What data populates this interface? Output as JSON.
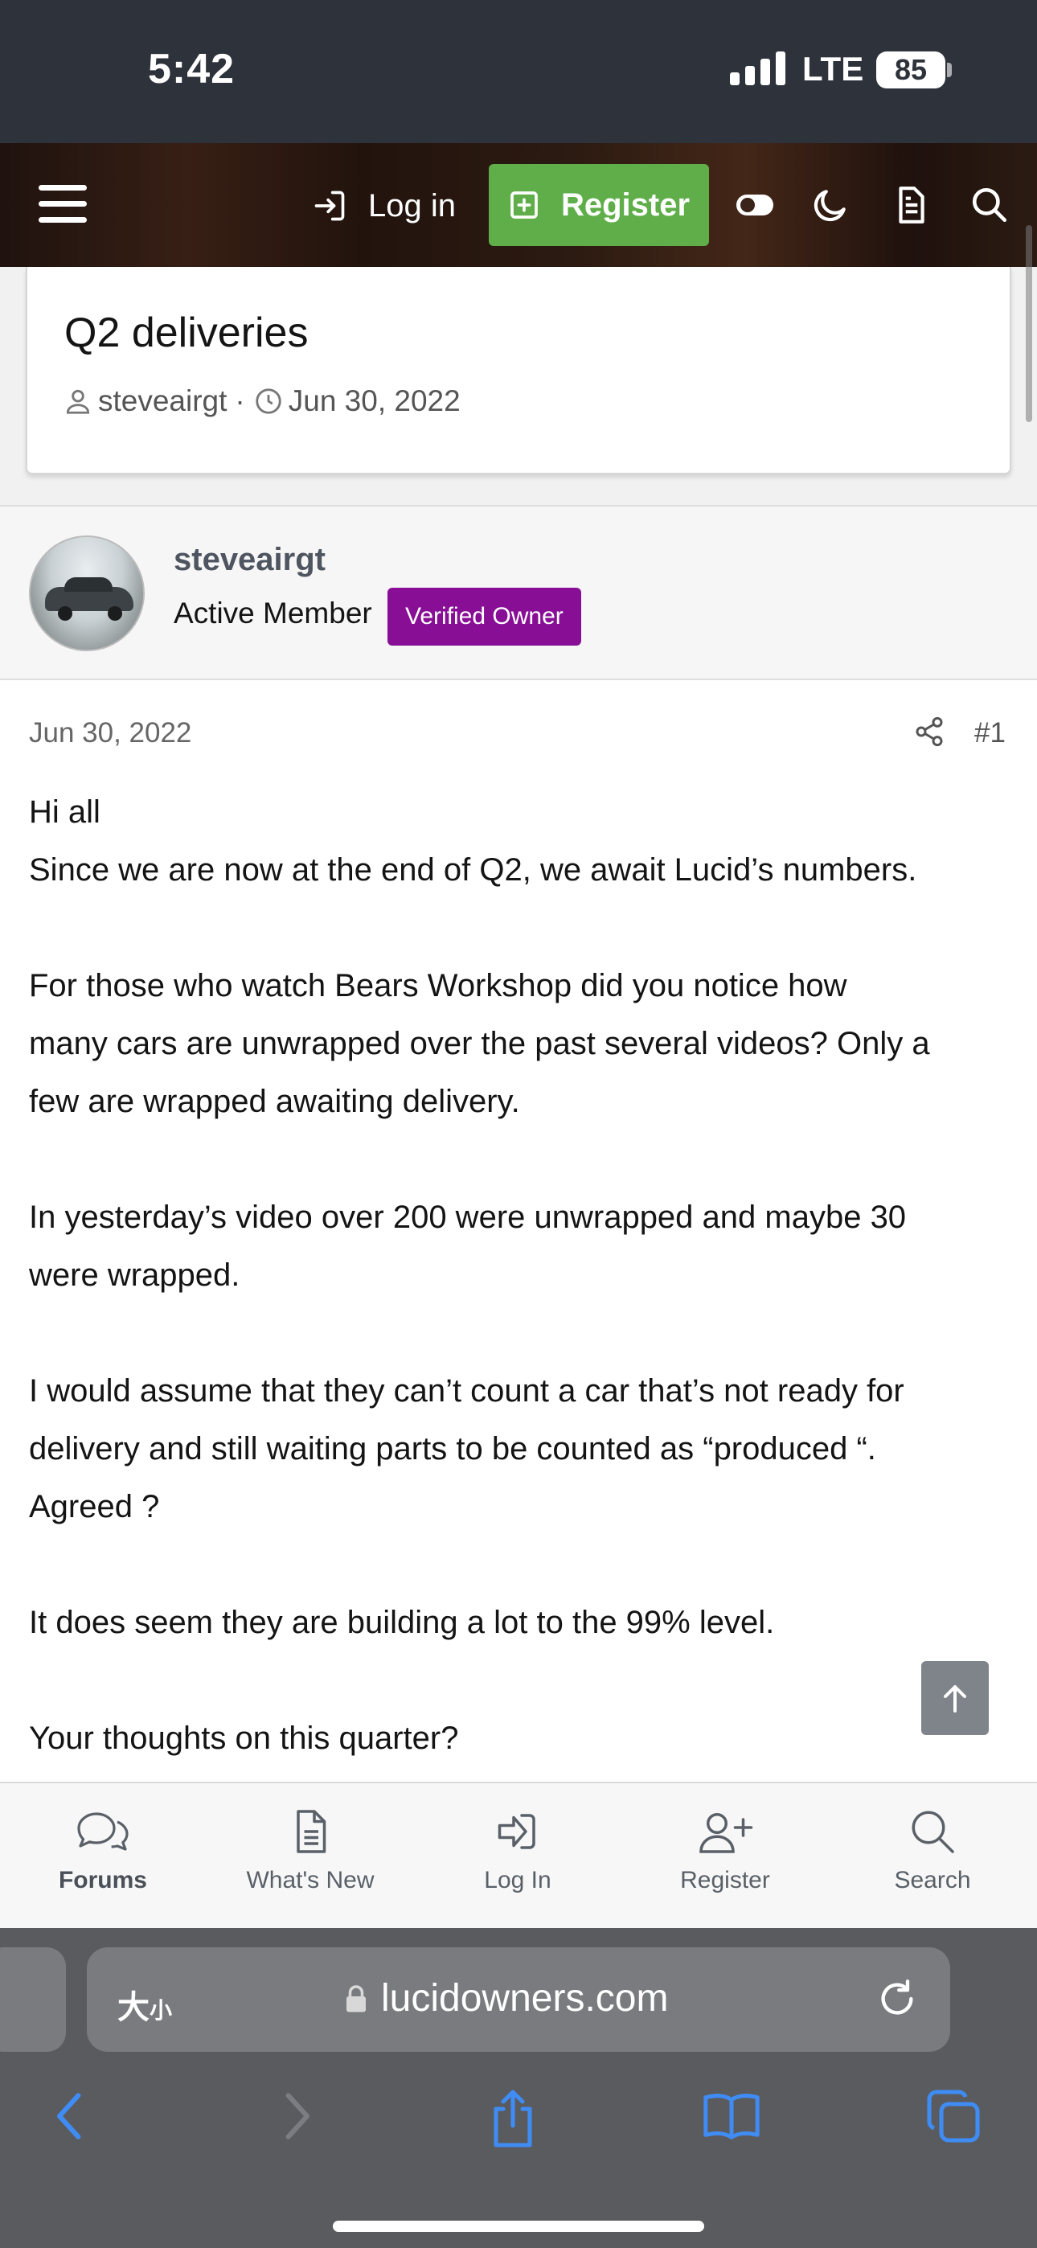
{
  "status_bar": {
    "time": "5:42",
    "network": "LTE",
    "battery": "85"
  },
  "header": {
    "login_label": "Log in",
    "register_label": "Register",
    "icons": [
      "menu-icon",
      "login-icon",
      "register-plus-icon",
      "toggle-icon",
      "moon-icon",
      "document-icon",
      "search-icon"
    ]
  },
  "thread": {
    "title": "Q2 deliveries",
    "author": "steveairgt",
    "date": "Jun 30, 2022"
  },
  "user": {
    "name": "steveairgt",
    "title": "Active Member",
    "badge": "Verified Owner",
    "badge_color": "#880e96"
  },
  "post": {
    "date": "Jun 30, 2022",
    "number": "#1",
    "lines": [
      "Hi all",
      "Since we are now at the end of Q2, we await Lucid’s numbers.",
      "",
      "For those who watch Bears Workshop did you notice how",
      "many cars are unwrapped over the past several videos? Only a",
      "few are wrapped awaiting delivery.",
      "",
      "In yesterday’s video over 200 were unwrapped and maybe 30",
      "were wrapped.",
      "",
      "I would assume that they can’t count a car that’s not ready for",
      "delivery and still waiting parts to be counted as “produced “.",
      "Agreed ?",
      "",
      "It does seem they are building a lot to the 99% level.",
      "",
      "Your thoughts on this quarter?"
    ]
  },
  "tabs": [
    {
      "label": "Forums",
      "icon": "chat-bubbles-icon",
      "active": true
    },
    {
      "label": "What's New",
      "icon": "document-icon",
      "active": false
    },
    {
      "label": "Log In",
      "icon": "login-icon",
      "active": false
    },
    {
      "label": "Register",
      "icon": "add-user-icon",
      "active": false
    },
    {
      "label": "Search",
      "icon": "search-icon",
      "active": false
    }
  ],
  "browser": {
    "text_size_label": "大",
    "text_size_small": "小",
    "url": "lucidowners.com"
  },
  "colors": {
    "register_green": "#5fae49",
    "ios_blue": "#3f8cf5",
    "status_bar_bg": "#2e333b"
  }
}
